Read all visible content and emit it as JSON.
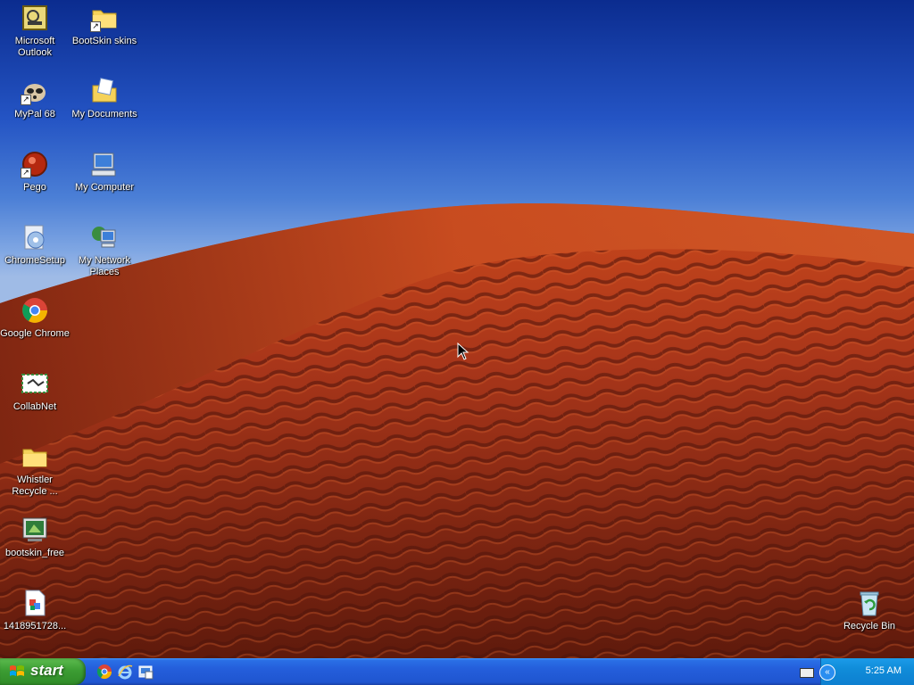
{
  "desktop": {
    "icons": [
      {
        "label": "Microsoft Outlook",
        "icon": "outlook-icon"
      },
      {
        "label": "BootSkin skins",
        "icon": "folder-icon"
      },
      {
        "label": "MyPal 68",
        "icon": "mypal-icon"
      },
      {
        "label": "My Documents",
        "icon": "my-documents-icon"
      },
      {
        "label": "Pego",
        "icon": "pego-icon"
      },
      {
        "label": "My Computer",
        "icon": "my-computer-icon"
      },
      {
        "label": "ChromeSetup",
        "icon": "chrome-setup-icon"
      },
      {
        "label": "My Network Places",
        "icon": "network-places-icon"
      },
      {
        "label": "Google Chrome",
        "icon": "chrome-icon"
      },
      {
        "label": "CollabNet",
        "icon": "collabnet-icon"
      },
      {
        "label": "Whistler Recycle ...",
        "icon": "folder-icon"
      },
      {
        "label": "bootskin_free",
        "icon": "bootskin-icon"
      },
      {
        "label": "1418951728...",
        "icon": "image-file-icon"
      },
      {
        "label": "Recycle Bin",
        "icon": "recycle-bin-icon"
      }
    ]
  },
  "taskbar": {
    "start_label": "start",
    "quick_launch": [
      "chrome-icon",
      "internet-explorer-icon",
      "show-desktop-icon"
    ],
    "clock": "5:25 AM",
    "colors": {
      "taskbar": "#245edb",
      "start": "#3c9d33",
      "tray": "#108cd9"
    }
  }
}
